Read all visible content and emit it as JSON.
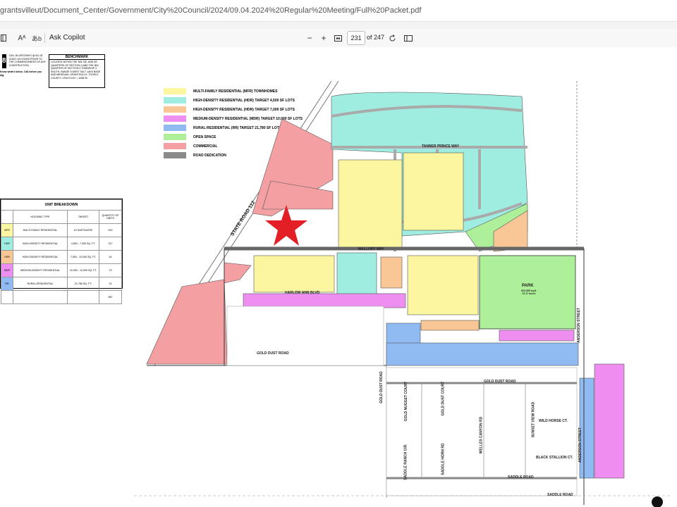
{
  "browser": {
    "url": "grantsvilleut/Document_Center/Government/City%20Council/2024/09.04.2024%20Regular%20Meeting/Full%20Packet.pdf"
  },
  "toolbar": {
    "read_aloud_icon": "Aᴬ",
    "translate_icon": "あb",
    "ask_copilot": "Ask Copilot",
    "zoom_out": "−",
    "zoom_in": "+",
    "page_input": "231",
    "page_total": "of 247"
  },
  "callout": {
    "text": "CALL BLUESTAKES @ 811 AT LEAST 48 HOURS PRIOR TO THE COMMENCEMENT OF ANY CONSTRUCTION.",
    "brand": "Know what's below. Call before you dig."
  },
  "benchmark": {
    "title": "BENCHMARK",
    "text": "LOCATED WITHIN THE NW, NE, AND SE QUARTERS OF SECTION 4 AND THE NW QUARTER OF SECTION 9 TOWNSHIP 3 SOUTH, RANGE 5 WEST SALT LAKE BASE AND MERIDIAN, GRANTSVILLE, TOOELE COUNTY, UTAH ELEV = 4288.90"
  },
  "legend": [
    {
      "label": "MULTI-FAMILY RESIDENTIAL (MFR) TOWNHOMES",
      "color": "#fdf6a0"
    },
    {
      "label": "HIGH-DENSITY RESIDENTIAL (HDR) TARGET 4,500 SF LOTS",
      "color": "#9fece0"
    },
    {
      "label": "HIGH-DENSITY RESIDENTIAL (HDR) TARGET 7,000 SF LOTS",
      "color": "#f9c796"
    },
    {
      "label": "MEDIUM-DENSITY RESIDENTIAL (MDR) TARGET 10,000 SF LOTS",
      "color": "#ee8ef0"
    },
    {
      "label": "RURAL-RESIDENTIAL (RR) TARGET 21,780 SF LOTS",
      "color": "#8fbbf2"
    },
    {
      "label": "OPEN SPACE",
      "color": "#aef09a"
    },
    {
      "label": "COMMERCIAL",
      "color": "#f4a0a2"
    },
    {
      "label": "ROAD DEDICATION",
      "color": "#8a8a8a"
    }
  ],
  "unit_breakdown": {
    "title": "UNIT BREAKDOWN",
    "headers": [
      "",
      "HOUSING TYPE",
      "TARGET",
      "QUANTITY OF UNITS"
    ],
    "rows": [
      {
        "code": "MFR",
        "type": "MULTI-FAMILY RESIDENTIAL",
        "target": "10 UNITS/ACRE",
        "qty": "515",
        "color": "#fdf6a0"
      },
      {
        "code": "HDR",
        "type": "HIGH-DENSITY RESIDENTIAL",
        "target": "4,500 - 7,000 SQ. FT.",
        "qty": "317",
        "color": "#9fece0"
      },
      {
        "code": "HDR",
        "type": "HIGH-DENSITY RESIDENTIAL",
        "target": "7,000 - 10,000 SQ. FT.",
        "qty": "44",
        "color": "#f9c796"
      },
      {
        "code": "MDR",
        "type": "MEDIUM-DENSITY RESIDENTIAL",
        "target": "10,000 - 12,000 SQ. FT.",
        "qty": "79",
        "color": "#ee8ef0"
      },
      {
        "code": "RR",
        "type": "RURAL-RESIDENTIAL",
        "target": "21,780 SQ. FT.",
        "qty": "31",
        "color": "#8fbbf2"
      }
    ],
    "total": "987"
  },
  "map_labels": {
    "state_road": "STATE ROAD 112",
    "tanner_prince": "TANNER PRINCE WAY",
    "mallory": "MALLORY WAY",
    "harlow": "HARLOW ANN BLVD.",
    "park": "PARK",
    "park_sub": "922,095 sq.ft. 21.17 acres",
    "anderson": "ANDERSON STREET",
    "gold_dust_1": "GOLD DUST ROAD",
    "gold_dust_2": "GOLD DUST ROAD",
    "gold_dust_vert": "GOLD DUST ROAD",
    "gold_nugget": "GOLD NUGGET COURT",
    "gold_dust_court": "GOLD DUST COURT",
    "welles_canyon": "WELLES CANYON RD",
    "sunset_view": "SUNSET VIEW ROAD",
    "wild_horse": "WILD HORSE CT.",
    "black_stallion": "BLACK STALLION CT.",
    "saddle_ranch": "SADDLE RANCH CIR.",
    "saddle_horn": "SADDLE HORN RD",
    "saddle_road_1": "SADDLE ROAD",
    "saddle_road_2": "SADDLE ROAD",
    "anderson_2": "ANDERSON STREET"
  }
}
